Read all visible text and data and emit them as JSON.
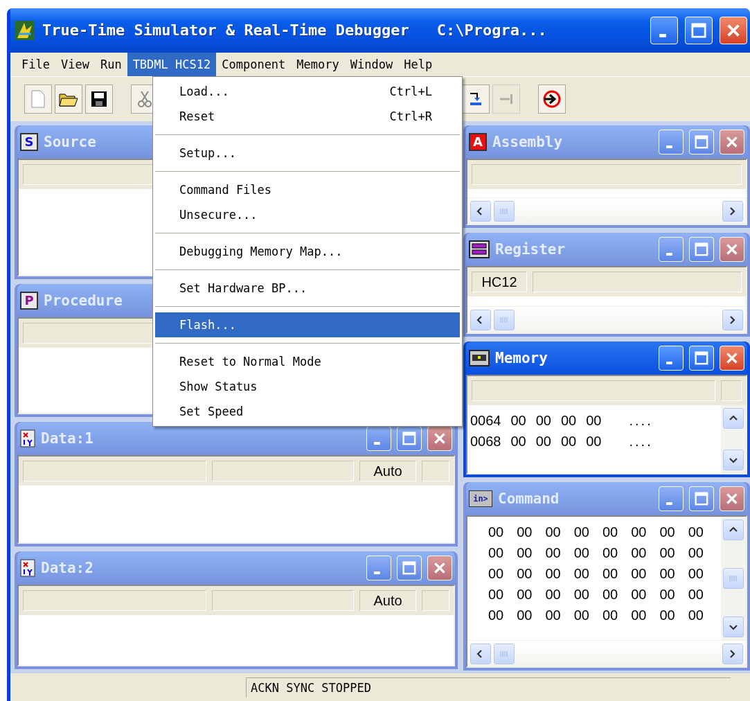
{
  "window": {
    "title": "True-Time Simulator & Real-Time Debugger",
    "path": "C:\\Progra..."
  },
  "menubar": [
    {
      "label": "File",
      "selected": false
    },
    {
      "label": "View",
      "selected": false
    },
    {
      "label": "Run",
      "selected": false
    },
    {
      "label": "TBDML HCS12",
      "selected": true
    },
    {
      "label": "Component",
      "selected": false
    },
    {
      "label": "Memory",
      "selected": false
    },
    {
      "label": "Window",
      "selected": false
    },
    {
      "label": "Help",
      "selected": false
    }
  ],
  "toolbar": [
    {
      "kind": "new",
      "disabled": false
    },
    {
      "kind": "open",
      "disabled": false
    },
    {
      "kind": "save",
      "disabled": false
    },
    {
      "kind": "separator"
    },
    {
      "kind": "cut",
      "disabled": false
    },
    {
      "kind": "spacer"
    },
    {
      "kind": "step",
      "disabled": false
    },
    {
      "kind": "stepout",
      "disabled": true
    },
    {
      "kind": "separator"
    },
    {
      "kind": "reset",
      "disabled": false
    }
  ],
  "menu": [
    {
      "kind": "item",
      "label": "Load...",
      "shortcut": "Ctrl+L",
      "selected": false
    },
    {
      "kind": "item",
      "label": "Reset",
      "shortcut": "Ctrl+R",
      "selected": false
    },
    {
      "kind": "separator"
    },
    {
      "kind": "item",
      "label": "Setup...",
      "selected": false
    },
    {
      "kind": "separator"
    },
    {
      "kind": "item",
      "label": "Command Files",
      "selected": false
    },
    {
      "kind": "item",
      "label": "Unsecure...",
      "selected": false
    },
    {
      "kind": "separator"
    },
    {
      "kind": "item",
      "label": "Debugging Memory Map...",
      "selected": false
    },
    {
      "kind": "separator"
    },
    {
      "kind": "item",
      "label": "Set Hardware BP...",
      "selected": false
    },
    {
      "kind": "separator"
    },
    {
      "kind": "item",
      "label": "Flash...",
      "selected": true
    },
    {
      "kind": "separator"
    },
    {
      "kind": "item",
      "label": "Reset to Normal Mode",
      "selected": false
    },
    {
      "kind": "item",
      "label": "Show Status",
      "selected": false
    },
    {
      "kind": "item",
      "label": "Set Speed",
      "selected": false
    }
  ],
  "mdi": {
    "left": [
      {
        "kind": "source",
        "title": "Source",
        "icon_text": "S",
        "active": false
      },
      {
        "kind": "procedure",
        "title": "Procedure",
        "icon_text": "P",
        "active": false
      },
      {
        "kind": "data",
        "title": "Data:1",
        "active": false,
        "mode": "Auto"
      },
      {
        "kind": "data",
        "title": "Data:2",
        "active": false,
        "mode": "Auto"
      }
    ],
    "right": [
      {
        "kind": "assembly",
        "title": "Assembly",
        "icon_text": "A",
        "active": false
      },
      {
        "kind": "register",
        "title": "Register",
        "active": false,
        "cpu": "HC12"
      },
      {
        "kind": "memory",
        "title": "Memory",
        "active": true,
        "rows": [
          {
            "address": "0064",
            "bytes": [
              "00",
              "00",
              "00",
              "00"
            ],
            "ascii": "...."
          },
          {
            "address": "0068",
            "bytes": [
              "00",
              "00",
              "00",
              "00"
            ],
            "ascii": "...."
          }
        ]
      },
      {
        "kind": "command",
        "title": "Command",
        "icon_text": "in>",
        "active": false,
        "rows": [
          [
            "00",
            "00",
            "00",
            "00",
            "00",
            "00",
            "00",
            "00"
          ],
          [
            "00",
            "00",
            "00",
            "00",
            "00",
            "00",
            "00",
            "00"
          ],
          [
            "00",
            "00",
            "00",
            "00",
            "00",
            "00",
            "00",
            "00"
          ],
          [
            "00",
            "00",
            "00",
            "00",
            "00",
            "00",
            "00",
            "00"
          ],
          [
            "00",
            "00",
            "00",
            "00",
            "00",
            "00",
            "00",
            "00"
          ]
        ]
      }
    ]
  },
  "status_bar": {
    "text": "ACKN SYNC STOPPED"
  }
}
